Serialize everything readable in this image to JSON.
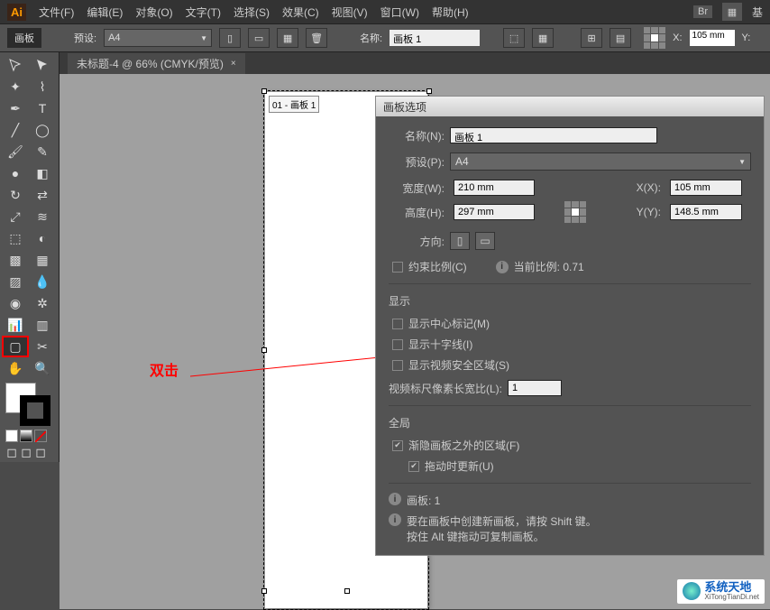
{
  "menubar": {
    "logo": "Ai",
    "items": [
      "文件(F)",
      "编辑(E)",
      "对象(O)",
      "文字(T)",
      "选择(S)",
      "效果(C)",
      "视图(V)",
      "窗口(W)",
      "帮助(H)"
    ],
    "br": "Br",
    "right_extra": "基"
  },
  "controlbar": {
    "artboard_label": "画板",
    "preset_label": "预设:",
    "preset_value": "A4",
    "name_label": "名称:",
    "name_value": "画板 1",
    "x_label": "X:",
    "x_value": "105 mm",
    "y_label": "Y:"
  },
  "tab": {
    "title": "未标题-4 @ 66% (CMYK/预览)",
    "close": "×"
  },
  "canvas": {
    "artboard_tag": "01 - 画板 1",
    "annotation": "双击"
  },
  "dialog": {
    "title": "画板选项",
    "name_label": "名称(N):",
    "name_value": "画板 1",
    "preset_label": "预设(P):",
    "preset_value": "A4",
    "width_label": "宽度(W):",
    "width_value": "210 mm",
    "height_label": "高度(H):",
    "height_value": "297 mm",
    "x_label": "X(X):",
    "x_value": "105 mm",
    "y_label": "Y(Y):",
    "y_value": "148.5 mm",
    "orient_label": "方向:",
    "constrain_label": "约束比例(C)",
    "ratio_label": "当前比例: 0.71",
    "display_head": "显示",
    "show_center": "显示中心标记(M)",
    "show_cross": "显示十字线(I)",
    "show_safe": "显示视频安全区域(S)",
    "pixel_ratio_label": "视频标尺像素长宽比(L):",
    "pixel_ratio_value": "1",
    "global_head": "全局",
    "fade_outside": "渐隐画板之外的区域(F)",
    "drag_update": "拖动时更新(U)",
    "artboards_label": "画板: 1",
    "hint_line1": "要在画板中创建新画板，请按 Shift 键。",
    "hint_line2": "按住 Alt 键拖动可复制画板。"
  },
  "watermark": {
    "main": "系统天地",
    "sub": "XiTongTianDi.net"
  }
}
